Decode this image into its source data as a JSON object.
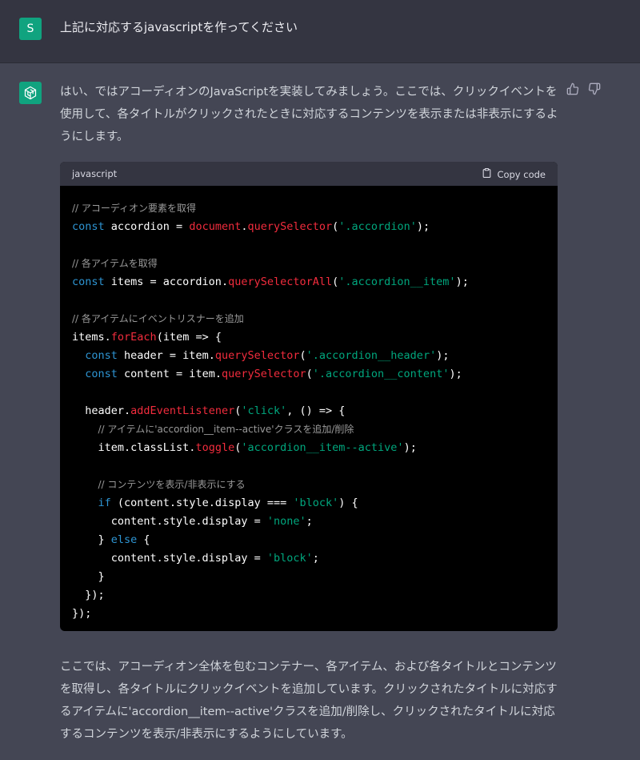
{
  "user_message": {
    "avatar_letter": "S",
    "text": "上記に対応するjavascriptを作ってください"
  },
  "assistant_message": {
    "intro": "はい、ではアコーディオンのJavaScriptを実装してみましょう。ここでは、クリックイベントを使用して、各タイトルがクリックされたときに対応するコンテンツを表示または非表示にするようにします。",
    "code_language": "javascript",
    "copy_label": "Copy code",
    "code_lines": [
      [
        {
          "t": "cm",
          "v": "// アコーディオン要素を取得"
        }
      ],
      [
        {
          "t": "kw",
          "v": "const"
        },
        {
          "t": "pl",
          "v": " accordion = "
        },
        {
          "t": "fn",
          "v": "document"
        },
        {
          "t": "pl",
          "v": "."
        },
        {
          "t": "fn",
          "v": "querySelector"
        },
        {
          "t": "pl",
          "v": "("
        },
        {
          "t": "str",
          "v": "'.accordion'"
        },
        {
          "t": "pl",
          "v": ");"
        }
      ],
      [],
      [
        {
          "t": "cm",
          "v": "// 各アイテムを取得"
        }
      ],
      [
        {
          "t": "kw",
          "v": "const"
        },
        {
          "t": "pl",
          "v": " items = accordion."
        },
        {
          "t": "fn",
          "v": "querySelectorAll"
        },
        {
          "t": "pl",
          "v": "("
        },
        {
          "t": "str",
          "v": "'.accordion__item'"
        },
        {
          "t": "pl",
          "v": ");"
        }
      ],
      [],
      [
        {
          "t": "cm",
          "v": "// 各アイテムにイベントリスナーを追加"
        }
      ],
      [
        {
          "t": "pl",
          "v": "items."
        },
        {
          "t": "fn",
          "v": "forEach"
        },
        {
          "t": "pl",
          "v": "(item => {"
        }
      ],
      [
        {
          "t": "pl",
          "v": "  "
        },
        {
          "t": "kw",
          "v": "const"
        },
        {
          "t": "pl",
          "v": " header = item."
        },
        {
          "t": "fn",
          "v": "querySelector"
        },
        {
          "t": "pl",
          "v": "("
        },
        {
          "t": "str",
          "v": "'.accordion__header'"
        },
        {
          "t": "pl",
          "v": ");"
        }
      ],
      [
        {
          "t": "pl",
          "v": "  "
        },
        {
          "t": "kw",
          "v": "const"
        },
        {
          "t": "pl",
          "v": " content = item."
        },
        {
          "t": "fn",
          "v": "querySelector"
        },
        {
          "t": "pl",
          "v": "("
        },
        {
          "t": "str",
          "v": "'.accordion__content'"
        },
        {
          "t": "pl",
          "v": ");"
        }
      ],
      [],
      [
        {
          "t": "pl",
          "v": "  header."
        },
        {
          "t": "fn",
          "v": "addEventListener"
        },
        {
          "t": "pl",
          "v": "("
        },
        {
          "t": "str",
          "v": "'click'"
        },
        {
          "t": "pl",
          "v": ", () => {"
        }
      ],
      [
        {
          "t": "pl",
          "v": "    "
        },
        {
          "t": "cm",
          "v": "// アイテムに'accordion__item--active'クラスを追加/削除"
        }
      ],
      [
        {
          "t": "pl",
          "v": "    item.classList."
        },
        {
          "t": "fn",
          "v": "toggle"
        },
        {
          "t": "pl",
          "v": "("
        },
        {
          "t": "str",
          "v": "'accordion__item--active'"
        },
        {
          "t": "pl",
          "v": ");"
        }
      ],
      [],
      [
        {
          "t": "pl",
          "v": "    "
        },
        {
          "t": "cm",
          "v": "// コンテンツを表示/非表示にする"
        }
      ],
      [
        {
          "t": "pl",
          "v": "    "
        },
        {
          "t": "kw",
          "v": "if"
        },
        {
          "t": "pl",
          "v": " (content.style.display === "
        },
        {
          "t": "str",
          "v": "'block'"
        },
        {
          "t": "pl",
          "v": ") {"
        }
      ],
      [
        {
          "t": "pl",
          "v": "      content.style.display = "
        },
        {
          "t": "str",
          "v": "'none'"
        },
        {
          "t": "pl",
          "v": ";"
        }
      ],
      [
        {
          "t": "pl",
          "v": "    } "
        },
        {
          "t": "kw",
          "v": "else"
        },
        {
          "t": "pl",
          "v": " {"
        }
      ],
      [
        {
          "t": "pl",
          "v": "      content.style.display = "
        },
        {
          "t": "str",
          "v": "'block'"
        },
        {
          "t": "pl",
          "v": ";"
        }
      ],
      [
        {
          "t": "pl",
          "v": "    }"
        }
      ],
      [
        {
          "t": "pl",
          "v": "  });"
        }
      ],
      [
        {
          "t": "pl",
          "v": "});"
        }
      ]
    ],
    "outro": "ここでは、アコーディオン全体を包むコンテナー、各アイテム、および各タイトルとコンテンツを取得し、各タイトルにクリックイベントを追加しています。クリックされたタイトルに対応するアイテムに'accordion__item--active'クラスを追加/削除し、クリックされたタイトルに対応するコンテンツを表示/非表示にするようにしています。"
  },
  "icons": {
    "assistant_avatar": "openai-logo-icon",
    "thumbs_up": "thumbs-up-icon",
    "thumbs_down": "thumbs-down-icon",
    "copy": "clipboard-icon"
  },
  "colors": {
    "accent": "#10a37f",
    "keyword": "#2e95d3",
    "function": "#f22c3d",
    "string": "#00a67d",
    "comment": "#9a9a9a"
  }
}
